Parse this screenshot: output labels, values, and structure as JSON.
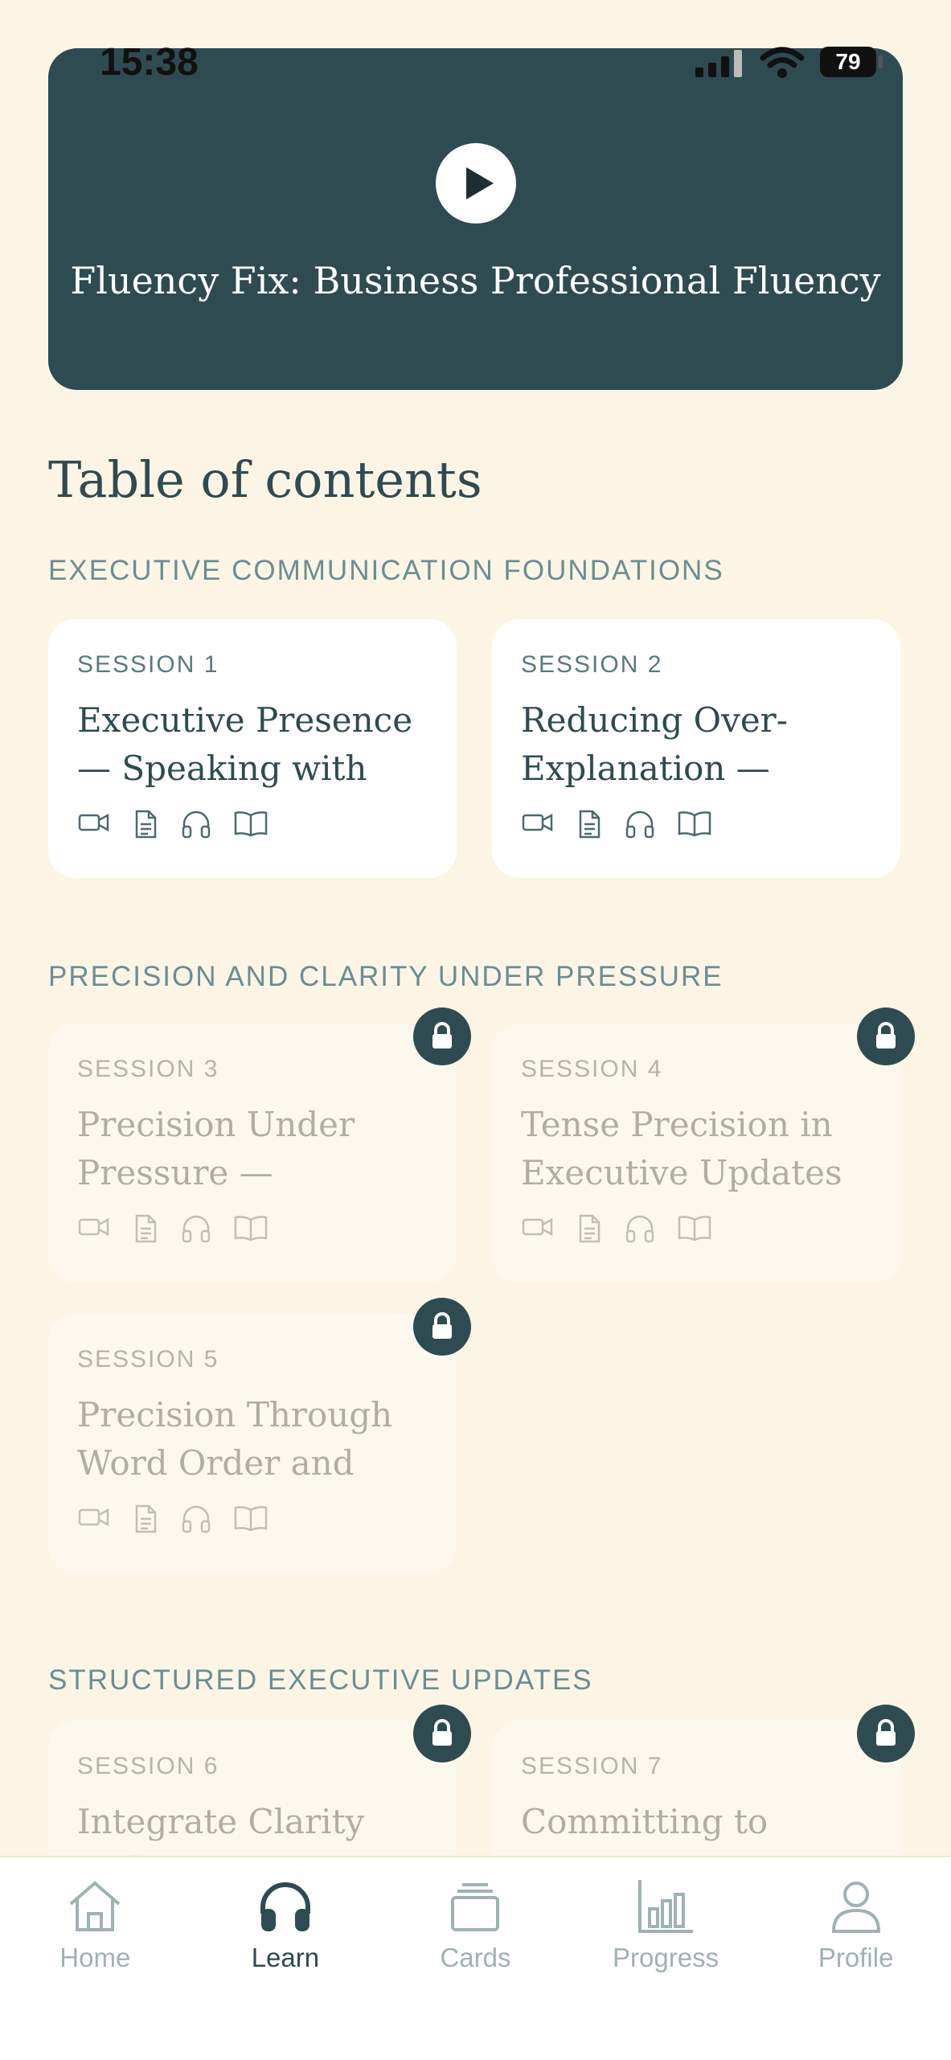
{
  "status_bar": {
    "time": "15:38",
    "battery": "79"
  },
  "hero": {
    "title": "Fluency Fix: Business Professional Fluency"
  },
  "toc_title": "Table of contents",
  "sections": [
    {
      "label": "EXECUTIVE COMMUNICATION FOUNDATIONS",
      "sessions": [
        {
          "session": "SESSION 1",
          "title": "Executive Presence — Speaking with A...",
          "locked": false
        },
        {
          "session": "SESSION 2",
          "title": "Reducing Over-Explanation — Spe...",
          "locked": false
        }
      ]
    },
    {
      "label": "PRECISION AND CLARITY UNDER PRESSURE",
      "sessions": [
        {
          "session": "SESSION 3",
          "title": "Precision Under Pressure — Adverb...",
          "locked": true
        },
        {
          "session": "SESSION 4",
          "title": "Tense Precision in Executive Updates",
          "locked": true
        },
        {
          "session": "SESSION 5",
          "title": "Precision Through Word Order and St...",
          "locked": true
        }
      ]
    },
    {
      "label": "STRUCTURED EXECUTIVE UPDATES",
      "sessions": [
        {
          "session": "SESSION 6",
          "title": "Integrate Clarity and",
          "locked": true
        },
        {
          "session": "SESSION 7",
          "title": "Committing to",
          "locked": true
        }
      ]
    }
  ],
  "content_icons": [
    "video-icon",
    "document-icon",
    "headphones-icon",
    "book-icon"
  ],
  "nav": [
    {
      "label": "Home",
      "icon": "home-icon"
    },
    {
      "label": "Learn",
      "icon": "headphones-icon",
      "active": true
    },
    {
      "label": "Cards",
      "icon": "cards-icon"
    },
    {
      "label": "Progress",
      "icon": "bar-chart-icon"
    },
    {
      "label": "Profile",
      "icon": "person-icon"
    }
  ],
  "colors": {
    "background": "#fcf5e5",
    "primary": "#2e4b51",
    "section_label": "#6a8e92"
  }
}
